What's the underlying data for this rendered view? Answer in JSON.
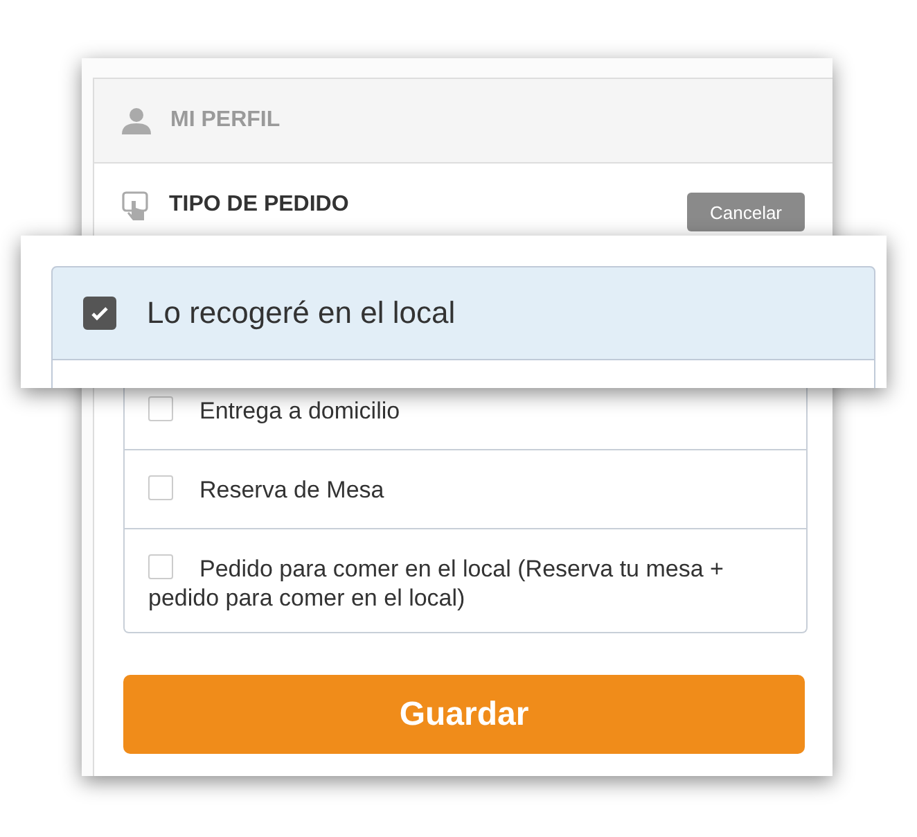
{
  "profile_row": {
    "label": "MI PERFIL"
  },
  "order_type": {
    "title": "TIPO DE PEDIDO",
    "cancel_button": "Cancelar"
  },
  "zoom_callout": {
    "label": "Lo recogeré en el local",
    "checked": true
  },
  "options": [
    {
      "label": "Entrega a domicilio",
      "checked": false
    },
    {
      "label": "Reserva de Mesa",
      "checked": false
    },
    {
      "label": "Pedido para comer en el local (Reserva tu mesa + pedido para comer en el local)",
      "checked": false
    }
  ],
  "save_button": "Guardar"
}
